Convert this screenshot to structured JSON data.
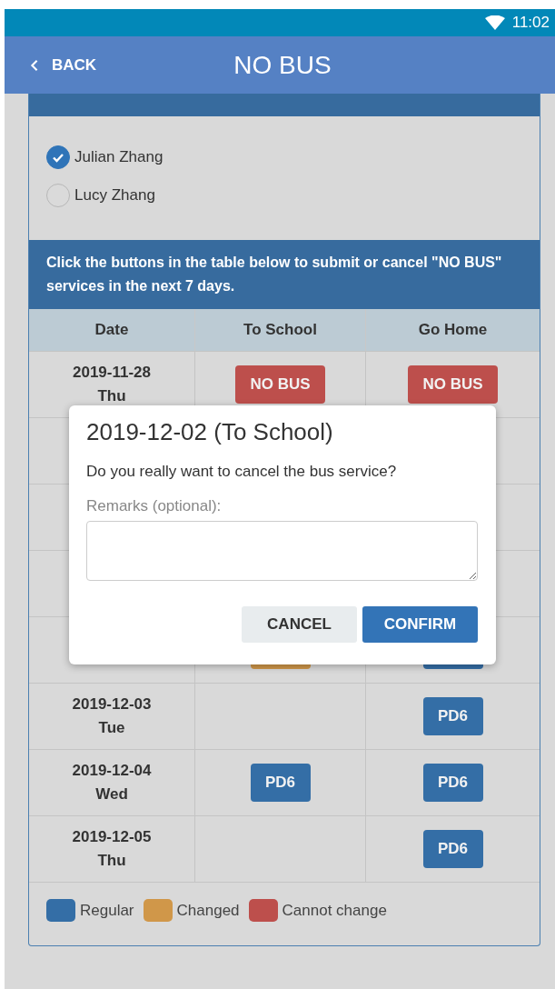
{
  "status_bar": {
    "time": "11:02"
  },
  "app_bar": {
    "back": "BACK",
    "title": "NO BUS"
  },
  "students": [
    {
      "name": "Julian Zhang",
      "selected": true
    },
    {
      "name": "Lucy Zhang",
      "selected": false
    }
  ],
  "info": "Click the buttons in the table below to submit or cancel \"NO BUS\" services in the next 7 days.",
  "table": {
    "columns": [
      "Date",
      "To School",
      "Go Home"
    ],
    "rows": [
      {
        "date": "2019-11-28",
        "day": "Thu",
        "to_school": {
          "kind": "cannot_change",
          "label": "NO BUS"
        },
        "go_home": {
          "kind": "cannot_change",
          "label": "NO BUS"
        }
      },
      {},
      {},
      {},
      {
        "to_school": {
          "kind": "changed"
        },
        "go_home": {
          "kind": "regular"
        }
      },
      {
        "date": "2019-12-03",
        "day": "Tue",
        "go_home": {
          "kind": "regular",
          "label": "PD6"
        }
      },
      {
        "date": "2019-12-04",
        "day": "Wed",
        "to_school": {
          "kind": "regular",
          "label": "PD6"
        },
        "go_home": {
          "kind": "regular",
          "label": "PD6"
        }
      },
      {
        "date": "2019-12-05",
        "day": "Thu",
        "go_home": {
          "kind": "regular",
          "label": "PD6"
        }
      }
    ]
  },
  "legend": [
    {
      "label": "Regular",
      "color": "#346ea6"
    },
    {
      "label": "Changed",
      "color": "#d09749"
    },
    {
      "label": "Cannot change",
      "color": "#bd4f4c"
    }
  ],
  "dialog": {
    "title": "2019-12-02 (To School)",
    "message": "Do you really want to cancel the bus service?",
    "remarks_label": "Remarks (optional):",
    "buttons": [
      {
        "label": "CANCEL",
        "kind": "secondary"
      },
      {
        "label": "CONFIRM",
        "kind": "primary"
      }
    ]
  }
}
